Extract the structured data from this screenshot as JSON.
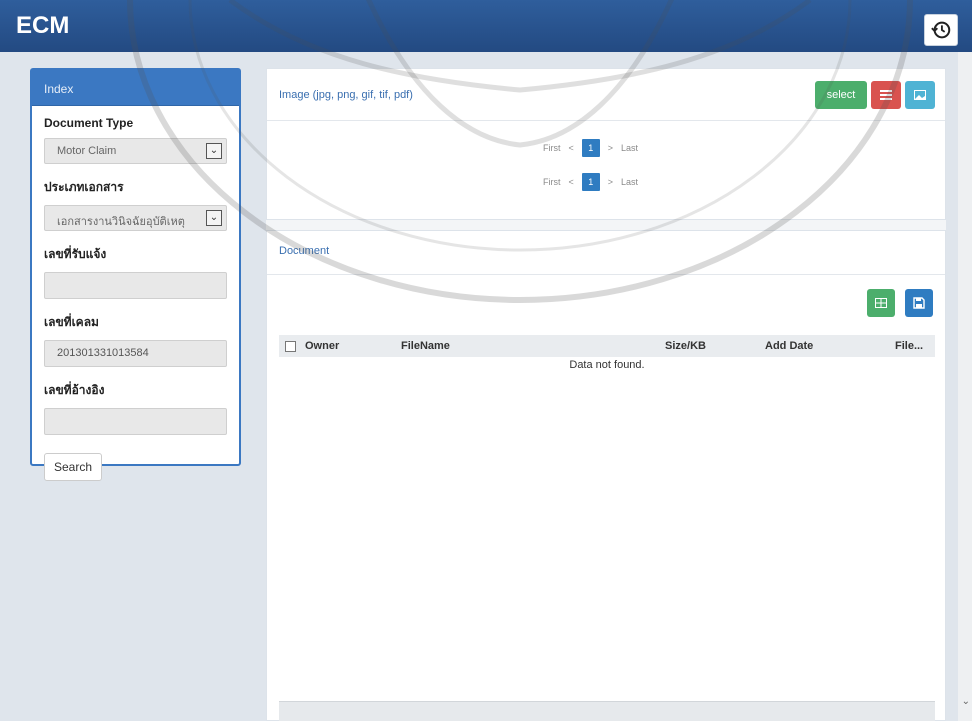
{
  "app": {
    "title": "ECM"
  },
  "sidebar": {
    "header": "Index",
    "fields": {
      "document_type": {
        "label": "Document Type",
        "value": "Motor Claim"
      },
      "doc_category": {
        "label": "ประเภทเอกสาร",
        "value": "เอกสารงานวินิจฉัยอุบัติเหตุ"
      },
      "notify_no": {
        "label": "เลขที่รับแจ้ง",
        "value": ""
      },
      "claim_no": {
        "label": "เลขที่เคลม",
        "value": "201301331013584"
      },
      "reference_no": {
        "label": "เลขที่อ้างอิง",
        "value": ""
      }
    },
    "search_label": "Search"
  },
  "image_panel": {
    "title": "Image (jpg, png, gif, tif, pdf)",
    "select_label": "select",
    "pager": {
      "first": "First",
      "prev": "<",
      "current": "1",
      "next": ">",
      "last": "Last"
    }
  },
  "document_panel": {
    "title": "Document",
    "columns": [
      "Owner",
      "FileName",
      "Size/KB",
      "Add Date",
      "File..."
    ],
    "empty_message": "Data not found."
  },
  "colors": {
    "header_bg": "#2f5e9c",
    "panel_accent": "#3b78c2",
    "btn_green": "#4cae6c",
    "btn_red": "#d9534f",
    "btn_cyan": "#4fb3d4",
    "btn_blue": "#2f7cc1"
  },
  "icons": [
    "history-icon",
    "list-icon",
    "image-icon",
    "excel-icon",
    "save-icon",
    "chevron-down-icon"
  ]
}
